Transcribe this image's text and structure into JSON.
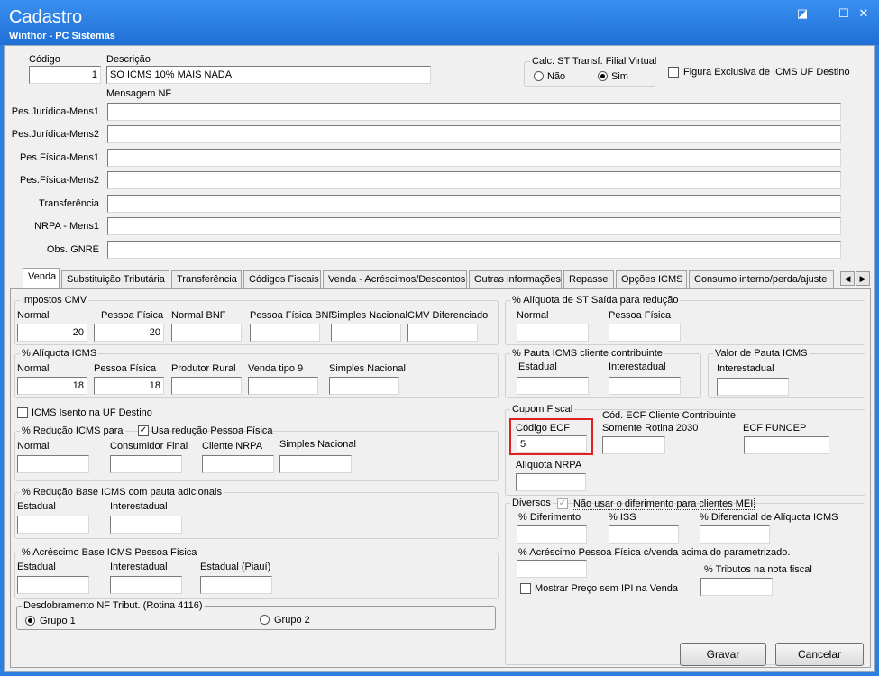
{
  "window": {
    "title": "Cadastro",
    "subtitle": "Winthor - PC Sistemas"
  },
  "header": {
    "codigo_label": "Código",
    "codigo_value": "1",
    "descricao_label": "Descrição",
    "descricao_value": "SO ICMS 10% MAIS NADA",
    "calc_st_title": "Calc. ST Transf. Filial Virtual",
    "nao": "Não",
    "sim": "Sim",
    "figura_label": "Figura Exclusiva de ICMS UF Destino",
    "mensagem_label": "Mensagem NF",
    "fields": [
      "Pes.Jurídica-Mens1",
      "Pes.Jurídica-Mens2",
      "Pes.Física-Mens1",
      "Pes.Física-Mens2",
      "Transferência",
      "NRPA - Mens1",
      "Obs. GNRE"
    ]
  },
  "tabs": [
    "Venda",
    "Substituição Tributária",
    "Transferência",
    "Códigos Fiscais",
    "Venda - Acréscimos/Descontos",
    "Outras informações",
    "Repasse",
    "Opções ICMS",
    "Consumo interno/perda/ajuste"
  ],
  "venda": {
    "cmv": {
      "title": "Impostos CMV",
      "labels": [
        "Normal",
        "Pessoa Física",
        "Normal BNF",
        "Pessoa Física BNF",
        "Simples Nacional",
        "CMV Diferenciado"
      ],
      "values": [
        "20",
        "20",
        "",
        "",
        "",
        ""
      ]
    },
    "aliq": {
      "title": "% Alíquota ICMS",
      "labels": [
        "Normal",
        "Pessoa Física",
        "Produtor Rural",
        "Venda tipo 9",
        "Simples Nacional"
      ],
      "values": [
        "18",
        "18",
        "",
        "",
        ""
      ]
    },
    "icms_isento": "ICMS Isento na UF Destino",
    "reducao": {
      "title": "% Redução ICMS para",
      "usa": "Usa redução Pessoa Física",
      "labels": [
        "Normal",
        "Consumidor Final",
        "Cliente NRPA",
        "Simples Nacional"
      ]
    },
    "red_base": {
      "title": "% Redução Base ICMS com pauta adicionais",
      "labels": [
        "Estadual",
        "Interestadual"
      ]
    },
    "acresc": {
      "title": "% Acréscimo Base ICMS Pessoa Física",
      "labels": [
        "Estadual",
        "Interestadual",
        "Estadual (Piauí)"
      ]
    },
    "desdob": {
      "title": "Desdobramento NF Tribut. (Rotina 4116)",
      "g1": "Grupo 1",
      "g2": "Grupo 2"
    },
    "st_saida": {
      "title": "% Alíquota de ST Saída para redução",
      "labels": [
        "Normal",
        "Pessoa Física"
      ]
    },
    "pauta": {
      "title": "% Pauta ICMS cliente contribuinte",
      "labels": [
        "Estadual",
        "Interestadual"
      ]
    },
    "valor_pauta": {
      "title": "Valor de Pauta ICMS",
      "label": "Interestadual"
    },
    "cupom": {
      "title": "Cupom Fiscal",
      "codigo_ecf": "Código ECF",
      "codigo_ecf_value": "5",
      "cod_ecf_cli": "Cód. ECF Cliente Contribuinte",
      "somente": "Somente Rotina 2030",
      "funcep": "ECF FUNCEP",
      "aliq_nrpa": "Alíquota NRPA"
    },
    "diversos": {
      "title": "Diversos",
      "nao_usar": "Não usar o diferimento para clientes MEI",
      "labels": [
        "% Diferimento",
        "% ISS",
        "% Diferencial de Alíquota ICMS"
      ],
      "acresc_pf": "% Acréscimo Pessoa Física c/venda acima do parametrizado.",
      "tributos": "% Tributos na nota fiscal",
      "mostrar": "Mostrar Preço sem IPI na Venda"
    }
  },
  "buttons": {
    "gravar": "Gravar",
    "cancelar": "Cancelar"
  }
}
